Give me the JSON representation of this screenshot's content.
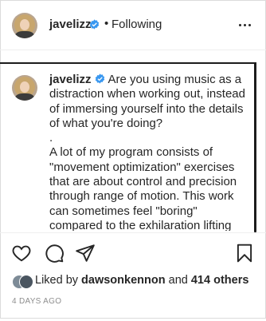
{
  "header": {
    "username": "javelizz",
    "separator": "•",
    "follow_status": "Following"
  },
  "caption": {
    "username": "javelizz",
    "text": "Are you using music as a\ndistraction when working out, instead\nof immersing yourself into the details\nof what you're doing?\n.\nA lot of my program consists of\n\"movement optimization\" exercises\nthat are about control and precision\nthrough range of motion. This work\ncan sometimes feel \"boring\"\ncompared to the exhilaration lifting"
  },
  "actions": {
    "like_icon": "heart-outline-icon",
    "comment_icon": "comment-bubble-icon",
    "share_icon": "paper-plane-icon",
    "save_icon": "bookmark-icon"
  },
  "likes": {
    "prefix": "Liked by",
    "first_liker": "dawsonkennon",
    "connector": "and",
    "others": "414 others"
  },
  "timestamp": "4 DAYS AGO",
  "colors": {
    "text": "#262626",
    "muted": "#8e8e8e",
    "verified_blue": "#3897f0",
    "border": "#dbdbdb"
  }
}
